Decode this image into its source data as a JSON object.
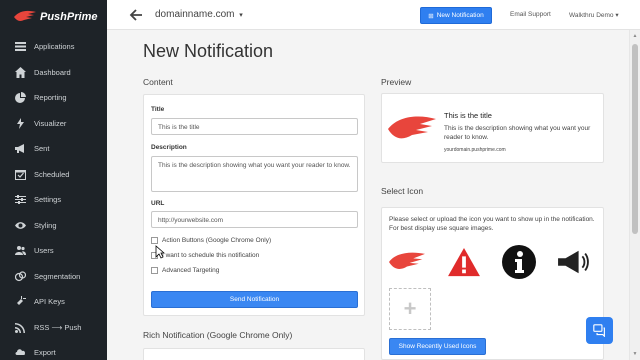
{
  "brand": {
    "name": "PushPrime",
    "accent": "#e8453c"
  },
  "sidebar": {
    "items": [
      {
        "label": "Applications",
        "icon": "menu-icon"
      },
      {
        "label": "Dashboard",
        "icon": "home-icon"
      },
      {
        "label": "Reporting",
        "icon": "pie-chart-icon"
      },
      {
        "label": "Visualizer",
        "icon": "bolt-icon"
      },
      {
        "label": "Sent",
        "icon": "bullhorn-icon"
      },
      {
        "label": "Scheduled",
        "icon": "calendar-check-icon"
      },
      {
        "label": "Settings",
        "icon": "sliders-icon"
      },
      {
        "label": "Styling",
        "icon": "eye-icon"
      },
      {
        "label": "Users",
        "icon": "users-icon"
      },
      {
        "label": "Segmentation",
        "icon": "venn-icon"
      },
      {
        "label": "API Keys",
        "icon": "plug-icon"
      },
      {
        "label": "RSS ⟶ Push",
        "icon": "rss-icon"
      },
      {
        "label": "Export",
        "icon": "cloud-download-icon"
      }
    ]
  },
  "topbar": {
    "domain": "domainname.com",
    "new_notification": "New Notification",
    "email_support": "Email Support",
    "walkthru": "Walkthru Demo"
  },
  "main": {
    "title": "New Notification",
    "content_label": "Content",
    "preview_label": "Preview",
    "select_icon_label": "Select Icon",
    "rich_label": "Rich Notification (Google Chrome Only)"
  },
  "form": {
    "title_label": "Title",
    "title_value": "This is the title",
    "description_label": "Description",
    "description_value": "This is the description showing what you want your reader to know.",
    "url_label": "URL",
    "url_value": "http://yourwebsite.com",
    "checkbox_action": "Action Buttons (Google Chrome Only)",
    "checkbox_schedule": "I want to schedule this notification",
    "checkbox_advanced": "Advanced Targeting",
    "send_button": "Send Notification"
  },
  "preview": {
    "title": "This is the title",
    "description": "This is the description showing what you want your reader to know.",
    "url": "yourdomain.pushprime.com"
  },
  "icons": {
    "instructions": "Please select or upload the icon you want to show up in the notification. For best display use square images.",
    "recent_button": "Show Recently Used Icons",
    "upload_symbol": "+",
    "choices": [
      "pushprime-wing-icon",
      "warning-triangle-icon",
      "info-circle-icon",
      "megaphone-icon"
    ]
  },
  "colors": {
    "sidebar_bg": "#1e2328",
    "primary_blue": "#2f7ff0",
    "warning_red": "#e02b2b"
  }
}
